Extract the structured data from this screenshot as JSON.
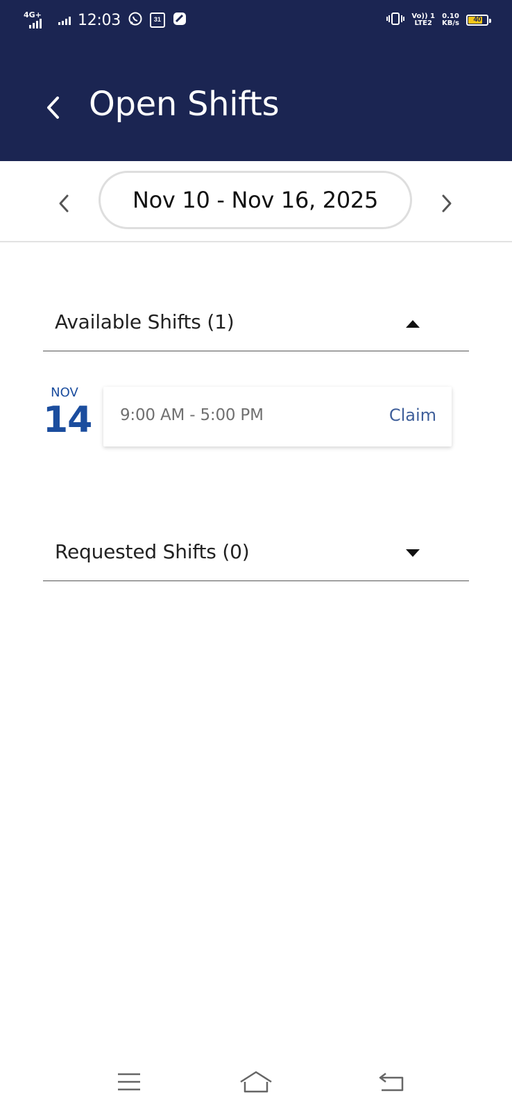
{
  "status_bar": {
    "network_type": "4G+",
    "time": "12:03",
    "volte_line1": "Vo)) 1",
    "volte_line2": "LTE2",
    "speed_value": "0.10",
    "speed_unit": "KB/s",
    "battery_level": "40",
    "notification_icons": [
      "whatsapp-icon",
      "calendar-icon",
      "app-icon"
    ],
    "calendar_icon_text": "31"
  },
  "header": {
    "title": "Open Shifts",
    "background_color": "#1b2552"
  },
  "week_navigation": {
    "date_range": "Nov 10 - Nov 16, 2025"
  },
  "sections": {
    "available": {
      "title": "Available Shifts (1)",
      "expanded": true,
      "shifts": [
        {
          "month": "NOV",
          "day": "14",
          "time": "9:00 AM - 5:00 PM",
          "action": "Claim"
        }
      ]
    },
    "requested": {
      "title": "Requested Shifts (0)",
      "expanded": false
    }
  },
  "colors": {
    "accent": "#1b4d9e",
    "claim": "#3f5f9a",
    "header": "#1b2552"
  }
}
